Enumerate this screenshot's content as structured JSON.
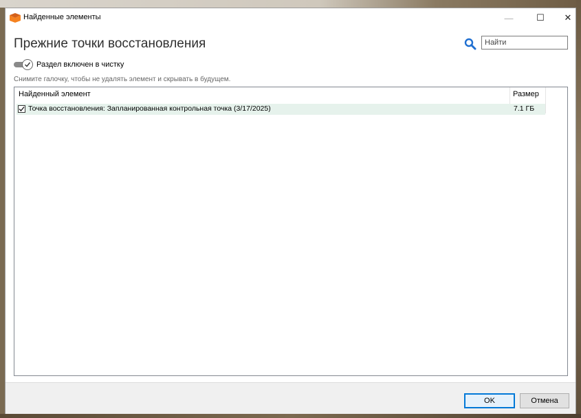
{
  "window": {
    "title": "Найденные элементы",
    "app_icon": "ccleaner-icon",
    "controls": {
      "minimize": "—",
      "maximize": "☐",
      "close": "✕"
    }
  },
  "heading": "Прежние точки восстановления",
  "search": {
    "placeholder": "Найти",
    "value": ""
  },
  "section_toggle": {
    "label": "Раздел включен в чистку",
    "enabled": true
  },
  "hint": "Снимите галочку, чтобы не удалять элемент и скрывать в будущем.",
  "table": {
    "columns": [
      "Найденный элемент",
      "Размер"
    ],
    "rows": [
      {
        "checked": true,
        "name": "Точка восстановления: Запланированная контрольная точка (3/17/2025)",
        "size": "7.1 ГБ"
      }
    ]
  },
  "buttons": {
    "ok": "OK",
    "cancel": "Отмена"
  },
  "colors": {
    "accent": "#0078d7",
    "row_highlight": "#e6f2ec",
    "icon_orange": "#f58220"
  }
}
